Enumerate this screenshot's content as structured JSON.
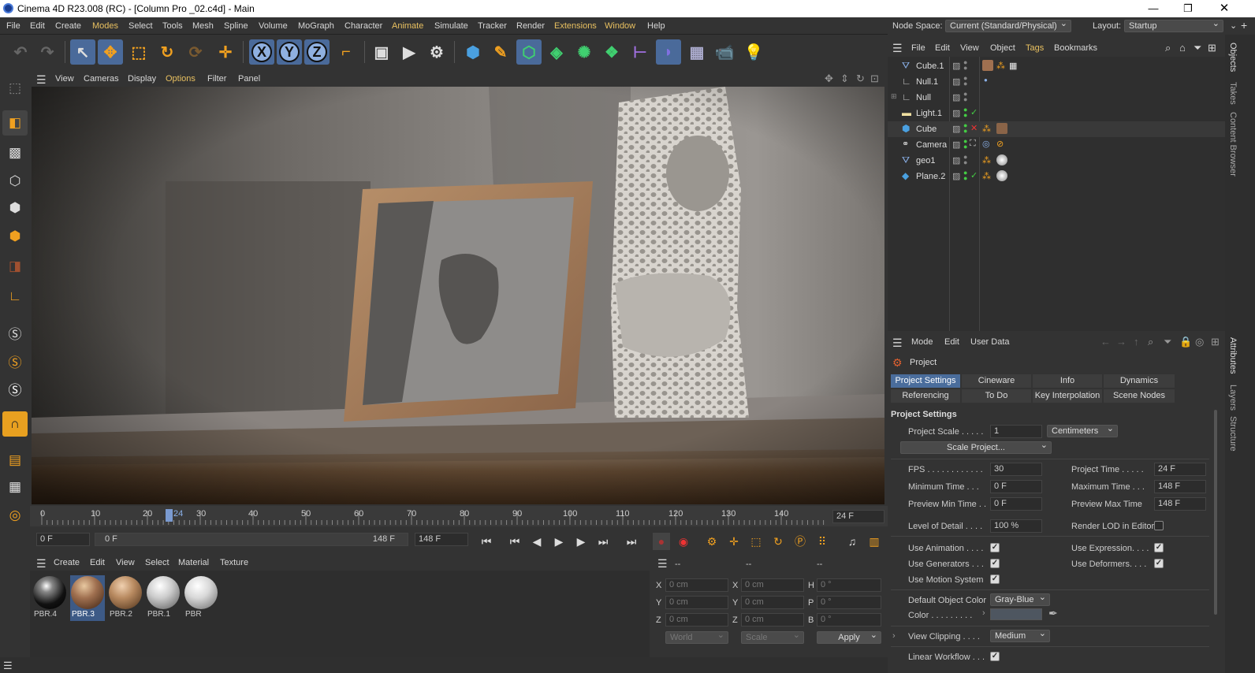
{
  "window": {
    "title": "Cinema 4D R23.008 (RC) - [Column Pro _02.c4d] - Main"
  },
  "menu": [
    "File",
    "Edit",
    "Create",
    "Modes",
    "Select",
    "Tools",
    "Mesh",
    "Spline",
    "Volume",
    "MoGraph",
    "Character",
    "Animate",
    "Simulate",
    "Tracker",
    "Render",
    "Extensions",
    "Window",
    "Help"
  ],
  "nodespace": {
    "label": "Node Space:",
    "value": "Current (Standard/Physical)",
    "layout_label": "Layout:",
    "layout_value": "Startup"
  },
  "toolbar": {
    "x_label": "X",
    "y_label": "Y",
    "z_label": "Z"
  },
  "viewport_menu": [
    "View",
    "Cameras",
    "Display",
    "Options",
    "Filter",
    "Panel"
  ],
  "timeline": {
    "ticks": [
      "0",
      "10",
      "20",
      "30",
      "40",
      "50",
      "60",
      "70",
      "80",
      "90",
      "100",
      "110",
      "120",
      "130",
      "140"
    ],
    "current": "24",
    "end_field": "24 F"
  },
  "transport": {
    "start": "0 F",
    "range_start": "0 F",
    "range_end": "148 F",
    "max": "148 F"
  },
  "material_menu": [
    "Create",
    "Edit",
    "View",
    "Select",
    "Material",
    "Texture"
  ],
  "materials": [
    {
      "name": "PBR.4"
    },
    {
      "name": "PBR.3"
    },
    {
      "name": "PBR.2"
    },
    {
      "name": "PBR.1"
    },
    {
      "name": "PBR"
    }
  ],
  "coords": {
    "headers": [
      "--",
      "--",
      "--"
    ],
    "x": "0 cm",
    "y": "0 cm",
    "z": "0 cm",
    "x2": "0 cm",
    "y2": "0 cm",
    "z2": "0 cm",
    "h": "0 °",
    "p": "0 °",
    "b": "0 °",
    "lx": "X",
    "ly": "Y",
    "lz": "Z",
    "lx2": "X",
    "ly2": "Y",
    "lz2": "Z",
    "lh": "H",
    "lp": "P",
    "lb": "B",
    "world": "World",
    "scale": "Scale",
    "apply": "Apply"
  },
  "object_menu": [
    "File",
    "Edit",
    "View",
    "Object",
    "Tags",
    "Bookmarks"
  ],
  "objects": [
    "Cube.1",
    "Null.1",
    "Null",
    "Light.1",
    "Cube",
    "Camera",
    "geo1",
    "Plane.2"
  ],
  "attr_menu": [
    "Mode",
    "Edit",
    "User Data"
  ],
  "attr": {
    "header": "Project",
    "tabs_row1": [
      "Project Settings",
      "Cineware",
      "Info",
      "Dynamics"
    ],
    "tabs_row2": [
      "Referencing",
      "To Do",
      "Key Interpolation",
      "Scene Nodes"
    ],
    "section": "Project Settings",
    "project_scale_label": "Project Scale . . . . .",
    "project_scale": "1",
    "project_scale_unit": "Centimeters",
    "scale_button": "Scale Project...",
    "fps_label": "FPS . . . . . . . . . . . .",
    "fps": "30",
    "project_time_label": "Project Time . . . . .",
    "project_time": "24 F",
    "min_time_label": "Minimum Time . . .",
    "min_time": "0 F",
    "max_time_label": "Maximum Time . . .",
    "max_time": "148 F",
    "pmin_label": "Preview Min Time . .",
    "pmin": "0 F",
    "pmax_label": "Preview Max Time",
    "pmax": "148 F",
    "lod_label": "Level of Detail . . . .",
    "lod": "100 %",
    "render_lod_label": "Render LOD in Editor",
    "use_anim_label": "Use Animation . . . .",
    "use_expr_label": "Use Expression. . . .",
    "use_gen_label": "Use Generators . . .",
    "use_def_label": "Use Deformers. . . .",
    "use_motion_label": "Use Motion System",
    "doc_label": "Default Object Color",
    "doc": "Gray-Blue",
    "color_label": "Color . . . . . . . . .",
    "clip_label": "View Clipping . . . .",
    "clip": "Medium",
    "linear_label": "Linear Workflow . . ."
  },
  "side_tabs": [
    "Objects",
    "Takes",
    "Content Browser",
    "Attributes",
    "Layers",
    "Structure"
  ],
  "colors": {
    "accent": "#4a6d9c",
    "highlight": "#e8c060",
    "bg": "#333333"
  }
}
